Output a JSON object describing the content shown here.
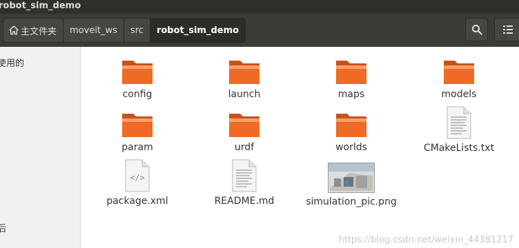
{
  "window": {
    "title": "robot_sim_demo"
  },
  "pathbar": {
    "crumbs": [
      {
        "label": "主文件夹",
        "icon": "home-icon"
      },
      {
        "label": "moveit_ws"
      },
      {
        "label": "src"
      },
      {
        "label": "robot_sim_demo",
        "current": true
      }
    ]
  },
  "toolbar": {
    "search_icon": "search-icon",
    "view_icon": "list-view-icon"
  },
  "sidebar": {
    "items": [
      {
        "label": "使用的"
      },
      {
        "label": "."
      },
      {
        "label": "后"
      }
    ]
  },
  "files": [
    {
      "name": "config",
      "type": "folder"
    },
    {
      "name": "launch",
      "type": "folder"
    },
    {
      "name": "maps",
      "type": "folder"
    },
    {
      "name": "models",
      "type": "folder"
    },
    {
      "name": "param",
      "type": "folder"
    },
    {
      "name": "urdf",
      "type": "folder"
    },
    {
      "name": "worlds",
      "type": "folder"
    },
    {
      "name": "CMakeLists.txt",
      "type": "text"
    },
    {
      "name": "package.xml",
      "type": "xml"
    },
    {
      "name": "README.md",
      "type": "text"
    },
    {
      "name": "simulation_pic.png",
      "type": "image"
    }
  ],
  "watermark": "https://blog.csdn.net/weixin_44381217",
  "colors": {
    "folder": "#e9621f",
    "folder_light": "#f59a5c",
    "header": "#3c3b37",
    "titlebar": "#2f2f2c"
  }
}
